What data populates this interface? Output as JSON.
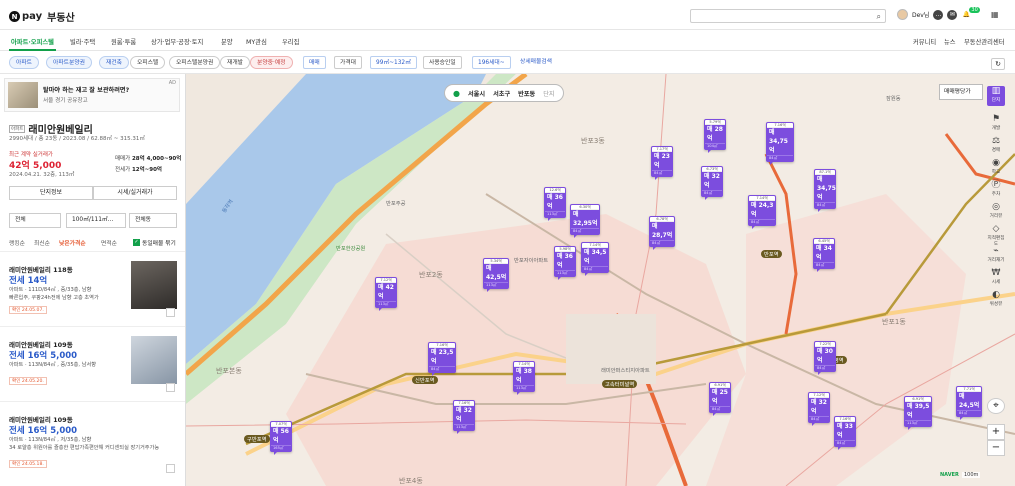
{
  "header": {
    "logo_n": "N",
    "logo_pay": "pay",
    "logo_service": "부동산",
    "user_name": "Dev님",
    "badge": "30"
  },
  "nav": {
    "items": [
      "아파트·오피스텔",
      "빌라·주택",
      "원룸·투룸",
      "상가·업무·공장·토지",
      "분양",
      "MY관심",
      "우리집"
    ],
    "right": [
      "커뮤니티",
      "뉴스",
      "부동산관리센터"
    ]
  },
  "filters": {
    "chips": [
      "아파트",
      "아파트분양권",
      "재건축",
      "오피스텔",
      "오피스텔분양권",
      "재개발",
      "분양중·예정"
    ],
    "dropdowns": [
      "매매",
      "가격대",
      "99㎡~132㎡",
      "사용승인일",
      "196세대~",
      "상세매물검색"
    ]
  },
  "panel": {
    "ad": {
      "title": "탈마야 하는 재고 잘 보관하려면?",
      "sub": "서울 경기 공유창고",
      "mark": "AD"
    },
    "complex_tag": "아파트",
    "complex": "래미안원베일리",
    "meta": "2990세대 / 총 23동 / 2023.08 / 62.88㎡ ~ 315.31㎡",
    "recent_label": "최근 계약 실거래가",
    "recent_price": "42억 5,000",
    "recent_date": "2024.04.21. 32층, 113㎡",
    "sale_label": "매매가",
    "sale_value": "28억 4,000~90억",
    "jeonse_label": "전세가",
    "jeonse_value": "12억~90억",
    "btn_info": "단지정보",
    "btn_price": "시세/실거래가",
    "sel1": "전체",
    "sel2": "100㎡/111㎡...",
    "sel3": "전체동",
    "sort": [
      "랭킹순",
      "최신순",
      "낮은가격순",
      "면적순"
    ],
    "check": "동일매물 묶기",
    "listings": [
      {
        "name": "래미안원베일리 118동",
        "price": "전세 14억",
        "desc": "아파트 · 111D/84㎡ , 중/33층, 남향",
        "desc2": "빠른입주, 쿠팡24h전에 남향 고층 초역가",
        "confirm": "확인 24.05.07."
      },
      {
        "name": "래미안원베일리 109동",
        "price": "전세 16억 5,000",
        "desc": "아파트 · 113N/84㎡ , 중/35층, 남서향",
        "desc2": "",
        "confirm": "확인 24.05.20."
      },
      {
        "name": "래미안원베일리 109동",
        "price": "전세 16억 5,000",
        "desc": "아파트 · 113N/84㎡ , 저/35층, 남향",
        "desc2": "34 로얄층 위원아를 즐층한 편답가족편안해 커디센되실 장기거주가능",
        "confirm": "확인 24.05.18."
      }
    ]
  },
  "map": {
    "location": {
      "city": "서울시",
      "gu": "서초구",
      "dong": "반포동",
      "type": "단지"
    },
    "map_type": "매매평당가",
    "tools": [
      "단지",
      "개발",
      "경매",
      "학교",
      "주차",
      "거리뷰",
      "지적편집도",
      "거리재기",
      "시세",
      "위성뷰"
    ],
    "zoom_in": "+",
    "zoom_out": "−",
    "scale": "100m",
    "naver": "NAVER",
    "price_pins": [
      {
        "head": "5.79억",
        "price": "매 28억",
        "area": "104㎡"
      },
      {
        "head": "7.16억",
        "price": "매 34,75억",
        "area": "84㎡"
      },
      {
        "head": "7.17억",
        "price": "매 23억",
        "area": "84㎡"
      },
      {
        "head": "6.73억",
        "price": "매 32억",
        "area": "84㎡"
      },
      {
        "head": "7.14억",
        "price": "매 24,3억",
        "area": "84㎡"
      },
      {
        "head": "87.1억",
        "price": "매 34,75억",
        "area": "84㎡"
      },
      {
        "head": "12.6억",
        "price": "매 36억",
        "area": "113㎡"
      },
      {
        "head": "6.30억",
        "price": "매 32,95억",
        "area": "84㎡"
      },
      {
        "head": "6.78억",
        "price": "매 28,7억",
        "area": "84㎡"
      },
      {
        "head": "7.14억",
        "price": "매 34,5억",
        "area": "84㎡"
      },
      {
        "head": "5.98억",
        "price": "매 36억",
        "area": "113㎡"
      },
      {
        "head": "5.34억",
        "price": "매 42,5억",
        "area": "113㎡"
      },
      {
        "head": "7.12억",
        "price": "매 42억",
        "area": "113㎡"
      },
      {
        "head": "6.45억",
        "price": "매 34억",
        "area": "84㎡"
      },
      {
        "head": "7.16억",
        "price": "매 23,5억",
        "area": "84㎡"
      },
      {
        "head": "7.14억",
        "price": "매 38억",
        "area": "113㎡"
      },
      {
        "head": "7.22억",
        "price": "매 30억",
        "area": "84㎡"
      },
      {
        "head": "7.16억",
        "price": "매 32억",
        "area": "113㎡"
      },
      {
        "head": "6.91억",
        "price": "매 25억",
        "area": "84㎡"
      },
      {
        "head": "7.12억",
        "price": "매 32억",
        "area": "84㎡"
      },
      {
        "head": "7.16억",
        "price": "매 33억",
        "area": "84㎡"
      },
      {
        "head": "6.91억",
        "price": "매 39,5억",
        "area": "113㎡"
      },
      {
        "head": "7.71억",
        "price": "매 24,5억",
        "area": "84㎡"
      },
      {
        "head": "7.07억",
        "price": "매 56억",
        "area": "165㎡"
      }
    ],
    "labels": [
      "반포3동",
      "반포2동",
      "반포1동",
      "반포본동",
      "반포4동",
      "반포주공",
      "반포자이아파트",
      "래미안퍼스티지아파트",
      "신반포역",
      "구반포역",
      "고속터미널역",
      "반포역",
      "사평역",
      "동작역",
      "잠원동",
      "반포한강공원"
    ]
  },
  "colors": {
    "accent": "#12a04a",
    "pin": "#7c4dde",
    "price_red": "#d22233",
    "link_blue": "#2a5ac8"
  }
}
